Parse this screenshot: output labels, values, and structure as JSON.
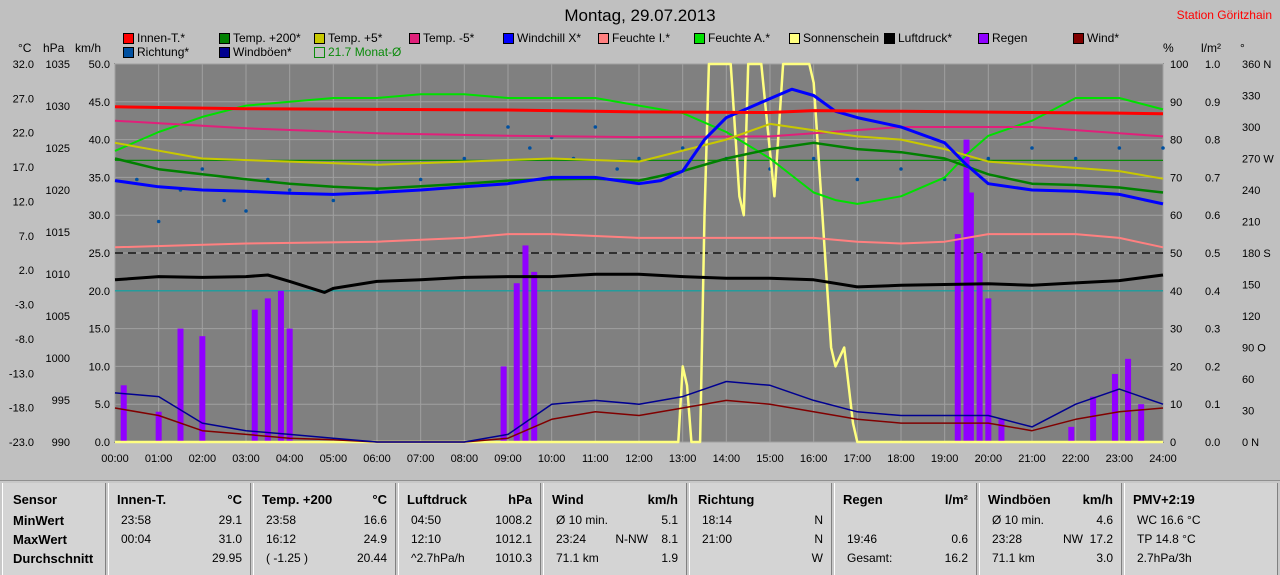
{
  "title": "Montag, 29.07.2013",
  "station": "Station Göritzhain",
  "units": {
    "c": "°C",
    "hpa": "hPa",
    "kmh": "km/h",
    "pct": "%",
    "lm2": "l/m²",
    "deg": "°"
  },
  "legend": [
    {
      "label": "Innen-T.*",
      "color": "#ff0000"
    },
    {
      "label": "Temp. +200*",
      "color": "#008000"
    },
    {
      "label": "Temp. +5*",
      "color": "#c8c800"
    },
    {
      "label": "Temp. -5*",
      "color": "#e0207a"
    },
    {
      "label": "Windchill X*",
      "color": "#0000ff"
    },
    {
      "label": "Feuchte I.*",
      "color": "#ff8080"
    },
    {
      "label": "Feuchte A.*",
      "color": "#00e000"
    },
    {
      "label": "Sonnenschein",
      "color": "#ffff80"
    },
    {
      "label": "Luftdruck*",
      "color": "#000000"
    },
    {
      "label": "Regen",
      "color": "#9000ff"
    },
    {
      "label": "Wind*",
      "color": "#800000"
    },
    {
      "label": "Richtung*",
      "color": "#0050a0"
    },
    {
      "label": "Windböen*",
      "color": "#000090"
    },
    {
      "label": "21.7 Monat-Ø",
      "color": "#0a8a0a",
      "open": true
    }
  ],
  "chart_data": {
    "type": "line",
    "title": "Montag, 29.07.2013",
    "x_ticks": [
      "00:00",
      "01:00",
      "02:00",
      "03:00",
      "04:00",
      "05:00",
      "06:00",
      "07:00",
      "08:00",
      "09:00",
      "10:00",
      "11:00",
      "12:00",
      "13:00",
      "14:00",
      "15:00",
      "16:00",
      "17:00",
      "18:00",
      "19:00",
      "20:00",
      "21:00",
      "22:00",
      "23:00",
      "24:00"
    ],
    "axes": {
      "temp_c": {
        "ticks": [
          "32.0",
          "27.0",
          "22.0",
          "17.0",
          "12.0",
          "7.0",
          "2.0",
          "-3.0",
          "-8.0",
          "-13.0",
          "-18.0",
          "-23.0"
        ],
        "range": [
          -23,
          37
        ]
      },
      "pressure_hpa": {
        "ticks": [
          "1035",
          "1030",
          "1025",
          "1020",
          "1015",
          "1010",
          "1005",
          "1000",
          "995",
          "990"
        ],
        "range": [
          990,
          1038
        ]
      },
      "wind_kmh": {
        "ticks": [
          "50.0",
          "45.0",
          "40.0",
          "35.0",
          "30.0",
          "25.0",
          "20.0",
          "15.0",
          "10.0",
          "5.0",
          "0.0"
        ],
        "range": [
          0,
          50
        ]
      },
      "humidity_pct": {
        "ticks": [
          "100",
          "90",
          "80",
          "70",
          "60",
          "50",
          "40",
          "30",
          "20",
          "10",
          "0"
        ],
        "range": [
          0,
          100
        ]
      },
      "rain_lm2": {
        "ticks": [
          "1.0",
          "0.9",
          "0.8",
          "0.7",
          "0.6",
          "0.5",
          "0.4",
          "0.3",
          "0.2",
          "0.1",
          "0.0"
        ],
        "range": [
          0,
          1
        ]
      },
      "direction_deg": {
        "ticks": [
          "360 N",
          "330",
          "300",
          "270 W",
          "240",
          "210",
          "180 S",
          "150",
          "120",
          "90 O",
          "60",
          "30",
          "0 N"
        ],
        "range": [
          0,
          360
        ]
      }
    },
    "series": [
      {
        "name": "Innen-T.*",
        "color": "#ff0000",
        "axis": "temp_c",
        "x": [
          0,
          3,
          6,
          9,
          12,
          15,
          16,
          18,
          21,
          23,
          24
        ],
        "y": [
          30.2,
          29.9,
          29.8,
          29.7,
          29.4,
          29.3,
          29.6,
          29.5,
          29.3,
          29.2,
          29.1
        ]
      },
      {
        "name": "Temp. +200*",
        "color": "#008000",
        "axis": "temp_c",
        "x": [
          0,
          1,
          2,
          3,
          4,
          5,
          6,
          7,
          8,
          9,
          10,
          11,
          12,
          13,
          14,
          15,
          16,
          17,
          18,
          19,
          20,
          21,
          22,
          23,
          24
        ],
        "y": [
          22.0,
          20.3,
          19.5,
          18.7,
          18.0,
          17.5,
          17.2,
          17.6,
          18.0,
          18.5,
          18.7,
          18.8,
          18.5,
          20.0,
          22.0,
          23.5,
          24.5,
          23.5,
          23.0,
          22.0,
          19.5,
          18.0,
          17.8,
          17.4,
          16.6
        ]
      },
      {
        "name": "Temp. +5*",
        "color": "#c8c800",
        "axis": "temp_c",
        "x": [
          0,
          2,
          4,
          6,
          8,
          10,
          12,
          14,
          15,
          16,
          17,
          18,
          19,
          20,
          21,
          22,
          23,
          24
        ],
        "y": [
          24.5,
          22.0,
          21.5,
          21.0,
          21.5,
          22.0,
          21.5,
          25.0,
          27.5,
          26.5,
          25.5,
          25.0,
          23.5,
          21.5,
          21.0,
          20.5,
          20.0,
          18.8
        ]
      },
      {
        "name": "Temp. -5*",
        "color": "#e0207a",
        "axis": "temp_c",
        "x": [
          0,
          3,
          6,
          9,
          12,
          15,
          18,
          21,
          24
        ],
        "y": [
          28.0,
          26.8,
          26.0,
          25.6,
          25.4,
          25.5,
          27.0,
          27.0,
          25.5
        ]
      },
      {
        "name": "Windchill X*",
        "color": "#0000ff",
        "axis": "temp_c",
        "x": [
          0,
          1,
          2,
          3,
          4,
          5,
          6,
          7,
          8,
          9,
          10,
          11,
          12,
          12.5,
          13,
          13.5,
          14,
          14.5,
          15,
          15.5,
          16,
          16.5,
          17,
          18,
          19,
          19.5,
          20,
          21,
          22,
          23,
          24
        ],
        "y": [
          18.5,
          17.5,
          17.0,
          16.8,
          16.5,
          16.3,
          16.6,
          17.0,
          17.5,
          18.0,
          19.0,
          19.0,
          18.0,
          18.5,
          20.0,
          25.0,
          28.5,
          30.0,
          31.5,
          33.0,
          32.0,
          29.5,
          28.5,
          27.0,
          24.5,
          21.0,
          18.0,
          17.0,
          16.8,
          16.3,
          14.8
        ]
      },
      {
        "name": "Feuchte I.*",
        "color": "#ff8080",
        "axis": "humidity_pct",
        "x": [
          0,
          3,
          6,
          8,
          9,
          10,
          12,
          14,
          16,
          17,
          18,
          19,
          20,
          21,
          22,
          23,
          24
        ],
        "y": [
          51.5,
          52.5,
          53,
          54,
          55,
          55,
          54,
          54,
          54,
          53,
          52.5,
          53,
          55,
          55,
          55,
          54,
          51.5
        ]
      },
      {
        "name": "Feuchte A.*",
        "color": "#00e000",
        "axis": "humidity_pct",
        "x": [
          0,
          1,
          2,
          3,
          4,
          5,
          6,
          7,
          8,
          9,
          10,
          11,
          12,
          13,
          14,
          15,
          16,
          16.5,
          17,
          18,
          19,
          19.5,
          20,
          21,
          22,
          23,
          24
        ],
        "y": [
          77,
          82,
          86,
          89,
          90,
          91,
          91,
          92,
          92,
          91,
          91,
          91,
          89,
          87,
          82,
          75,
          66,
          64,
          63,
          65,
          70,
          76,
          81,
          85,
          91,
          91,
          88
        ]
      },
      {
        "name": "Sonnenschein",
        "color": "#ffff80",
        "axis": "humidity_pct",
        "x": [
          0,
          12.9,
          13,
          13.1,
          13.2,
          13.4,
          13.5,
          13.6,
          14.0,
          14.05,
          14.1,
          14.3,
          14.4,
          14.5,
          14.6,
          14.8,
          15.1,
          15.3,
          15.5,
          15.7,
          15.9,
          16.0,
          16.2,
          16.4,
          16.5,
          16.7,
          16.9,
          17.0,
          24
        ],
        "y": [
          0,
          0,
          20,
          15,
          0,
          0,
          60,
          100,
          100,
          100,
          100,
          65,
          60,
          100,
          100,
          100,
          65,
          100,
          100,
          100,
          100,
          95,
          60,
          25,
          20,
          25,
          5,
          0,
          0
        ]
      },
      {
        "name": "Luftdruck*",
        "color": "#000000",
        "axis": "pressure_hpa",
        "x": [
          0,
          1,
          2,
          3,
          3.5,
          4,
          4.8,
          5,
          6,
          7,
          8,
          9,
          10,
          11,
          12,
          13,
          14,
          15,
          16,
          17,
          18,
          19,
          20,
          21,
          22,
          23,
          24
        ],
        "y": [
          1010.6,
          1011.0,
          1010.9,
          1011.0,
          1011.2,
          1010.4,
          1009.0,
          1009.5,
          1010.4,
          1010.6,
          1010.9,
          1011.0,
          1011.0,
          1011.3,
          1011.3,
          1011.0,
          1010.8,
          1010.8,
          1010.6,
          1009.7,
          1009.9,
          1010.0,
          1010.1,
          1009.9,
          1010.2,
          1010.5,
          1011.2
        ]
      },
      {
        "name": "Wind*",
        "color": "#800000",
        "axis": "wind_kmh",
        "x": [
          0,
          1,
          2,
          3,
          4,
          5,
          6,
          7,
          8,
          9,
          10,
          11,
          12,
          13,
          14,
          15,
          16,
          17,
          18,
          19,
          20,
          21,
          22,
          23,
          24
        ],
        "y": [
          4.5,
          3.5,
          1.5,
          1,
          0.5,
          0.3,
          0,
          0,
          0,
          0.5,
          3.0,
          4.0,
          3.5,
          4.5,
          5.5,
          5.0,
          4.0,
          3.0,
          2.5,
          2.5,
          2.5,
          1.5,
          3.0,
          4.0,
          4.5
        ]
      },
      {
        "name": "Windböen*",
        "color": "#000090",
        "axis": "wind_kmh",
        "x": [
          0,
          1,
          2,
          3,
          4,
          5,
          6,
          7,
          8,
          9,
          10,
          11,
          12,
          13,
          14,
          15,
          16,
          17,
          18,
          19,
          20,
          21,
          22,
          23,
          24
        ],
        "y": [
          6.5,
          6,
          2.5,
          1.5,
          1,
          0.5,
          0,
          0,
          0,
          1,
          5,
          5.5,
          5,
          6,
          8,
          7.5,
          5.5,
          4,
          3.5,
          3.5,
          3.5,
          2,
          5,
          7,
          5
        ]
      }
    ],
    "rain_bars": {
      "name": "Regen",
      "color": "#9000ff",
      "axis": "rain_lm2",
      "x": [
        0.2,
        1.0,
        1.5,
        2.0,
        3.2,
        3.5,
        3.8,
        4.0,
        8.9,
        9.2,
        9.4,
        9.6,
        19.3,
        19.5,
        19.6,
        19.8,
        20.0,
        20.3,
        21.9,
        22.4,
        22.9,
        23.2,
        23.5
      ],
      "y": [
        0.15,
        0.08,
        0.3,
        0.28,
        0.35,
        0.38,
        0.4,
        0.3,
        0.2,
        0.42,
        0.52,
        0.45,
        0.55,
        0.8,
        0.66,
        0.5,
        0.38,
        0.06,
        0.04,
        0.12,
        0.18,
        0.22,
        0.1
      ]
    },
    "direction": {
      "name": "Richtung*",
      "color": "#0050a0",
      "axis": "direction_deg",
      "x": [
        0.5,
        1,
        1.5,
        2,
        2.5,
        3,
        3.5,
        4,
        5,
        6,
        7,
        8,
        9,
        9.5,
        10,
        10.5,
        11,
        11.5,
        12,
        13,
        14,
        15,
        16,
        17,
        18,
        19,
        20,
        21,
        22,
        23,
        24
      ],
      "y": [
        250,
        210,
        240,
        260,
        230,
        220,
        250,
        240,
        230,
        240,
        250,
        270,
        300,
        280,
        290,
        270,
        300,
        260,
        270,
        280,
        270,
        260,
        270,
        250,
        260,
        250,
        270,
        280,
        270,
        280,
        280
      ]
    },
    "reference_lines": [
      {
        "label": "21.7 Monat-Ø",
        "axis": "temp_c",
        "value": 21.7,
        "color": "#0a8a0a"
      },
      {
        "axis": "wind_kmh",
        "value": 25,
        "color": "#000000",
        "style": "dashed"
      },
      {
        "axis": "wind_kmh",
        "value": 20,
        "color": "#00a0a0"
      }
    ]
  },
  "table": {
    "sensor": {
      "head": "Sensor",
      "rows": [
        "MinWert",
        "MaxWert",
        "Durchschnitt"
      ]
    },
    "columns": [
      {
        "head": "Innen-T.",
        "unit": "°C",
        "rows": [
          [
            "23:58",
            "",
            "29.1"
          ],
          [
            "00:04",
            "",
            "31.0"
          ],
          [
            "",
            "",
            "29.95"
          ]
        ]
      },
      {
        "head": "Temp. +200",
        "unit": "°C",
        "rows": [
          [
            "23:58",
            "",
            "16.6"
          ],
          [
            "16:12",
            "",
            "24.9"
          ],
          [
            "( -1.25 )",
            "",
            "20.44"
          ]
        ]
      },
      {
        "head": "Luftdruck",
        "unit": "hPa",
        "rows": [
          [
            "04:50",
            "",
            "1008.2"
          ],
          [
            "12:10",
            "",
            "1012.1"
          ],
          [
            "^2.7hPa/h",
            "",
            "1010.3"
          ]
        ]
      },
      {
        "head": "Wind",
        "unit": "km/h",
        "rows": [
          [
            "Ø 10 min.",
            "",
            "5.1"
          ],
          [
            "23:24",
            "N-NW",
            "8.1"
          ],
          [
            "71.1 km",
            "",
            "1.9"
          ]
        ]
      },
      {
        "head": "Richtung",
        "unit": "",
        "rows": [
          [
            "18:14",
            "",
            "N"
          ],
          [
            "21:00",
            "",
            "N"
          ],
          [
            "",
            "",
            "W"
          ]
        ]
      },
      {
        "head": "Regen",
        "unit": "l/m²",
        "rows": [
          [
            "",
            "",
            ""
          ],
          [
            "19:46",
            "",
            "0.6"
          ],
          [
            "Gesamt:",
            "",
            "16.2"
          ]
        ]
      },
      {
        "head": "Windböen",
        "unit": "km/h",
        "rows": [
          [
            "Ø 10 min.",
            "",
            "4.6"
          ],
          [
            "23:28",
            "NW",
            "17.2"
          ],
          [
            "71.1 km",
            "",
            "3.0"
          ]
        ]
      },
      {
        "head": "PMV+2:19",
        "unit": "",
        "rows": [
          [
            "WC 16.6 °C",
            "",
            ""
          ],
          [
            "TP 14.8 °C",
            "",
            ""
          ],
          [
            "2.7hPa/3h",
            "",
            ""
          ]
        ]
      }
    ]
  }
}
